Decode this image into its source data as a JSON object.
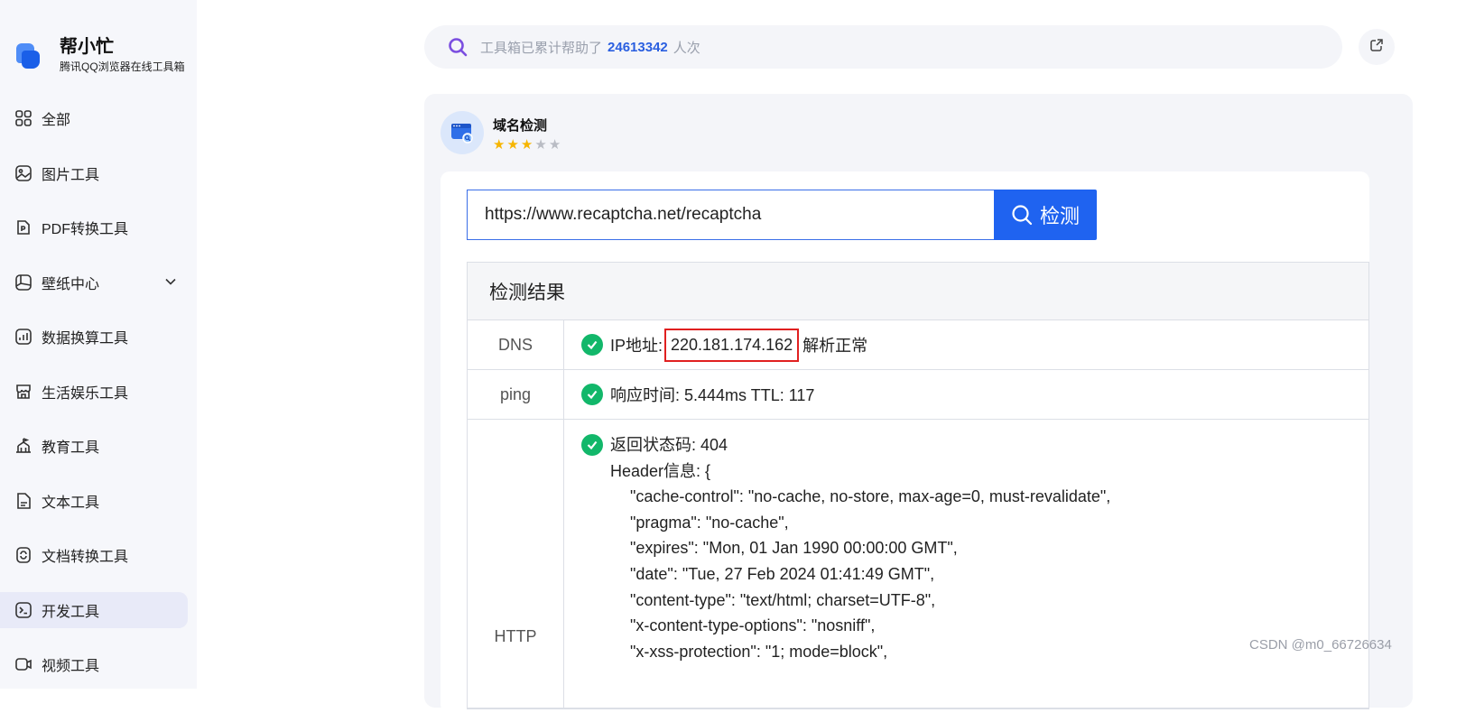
{
  "brand": {
    "name": "帮小忙",
    "subtitle": "腾讯QQ浏览器在线工具箱"
  },
  "sidebar": {
    "items": [
      {
        "label": "全部",
        "icon": "grid-icon"
      },
      {
        "label": "图片工具",
        "icon": "image-icon"
      },
      {
        "label": "PDF转换工具",
        "icon": "pdf-icon"
      },
      {
        "label": "壁纸中心",
        "icon": "wallpaper-icon",
        "expandable": true
      },
      {
        "label": "数据换算工具",
        "icon": "chart-icon"
      },
      {
        "label": "生活娱乐工具",
        "icon": "store-icon"
      },
      {
        "label": "教育工具",
        "icon": "school-icon"
      },
      {
        "label": "文本工具",
        "icon": "text-doc-icon"
      },
      {
        "label": "文档转换工具",
        "icon": "convert-doc-icon"
      },
      {
        "label": "开发工具",
        "icon": "terminal-icon",
        "active": true
      },
      {
        "label": "视频工具",
        "icon": "video-icon"
      }
    ]
  },
  "search": {
    "prefix": "工具箱已累计帮助了",
    "count": "24613342",
    "suffix": "人次"
  },
  "tool": {
    "title": "域名检测",
    "rating": 3,
    "max_rating": 5
  },
  "form": {
    "url_value": "https://www.recaptcha.net/recaptcha",
    "button_label": "检测"
  },
  "result": {
    "heading": "检测结果",
    "dns": {
      "label": "DNS",
      "prefix": "IP地址:",
      "ip": "220.181.174.162",
      "suffix": "解析正常"
    },
    "ping": {
      "label": "ping",
      "text": "响应时间: 5.444ms TTL: 117"
    },
    "http": {
      "label": "HTTP",
      "status": "返回状态码: 404",
      "header_title": "Header信息: {",
      "header_lines": [
        "\"cache-control\": \"no-cache, no-store, max-age=0, must-revalidate\",",
        "\"pragma\": \"no-cache\",",
        "\"expires\": \"Mon, 01 Jan 1990 00:00:00 GMT\",",
        "\"date\": \"Tue, 27 Feb 2024 01:41:49 GMT\",",
        "\"content-type\": \"text/html; charset=UTF-8\",",
        "\"x-content-type-options\": \"nosniff\",",
        "\"x-xss-protection\": \"1; mode=block\","
      ]
    }
  },
  "watermark": "CSDN @m0_66726634",
  "colors": {
    "accent": "#1f63f0",
    "success": "#12b76a",
    "highlight_border": "#e02020",
    "star": "#f6b500"
  }
}
